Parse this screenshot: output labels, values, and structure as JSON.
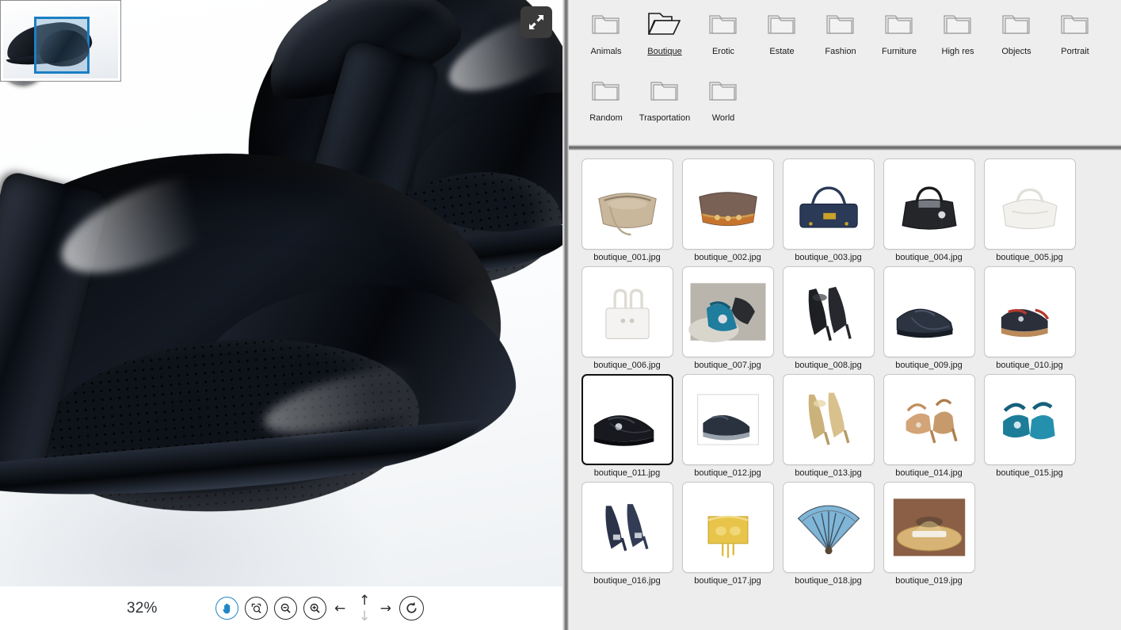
{
  "viewer": {
    "zoom_level": "32%",
    "navigator": {
      "name": "navigator-overview"
    },
    "fullscreen_icon": "expand-icon",
    "tools": [
      {
        "id": "pan",
        "icon": "hand-icon",
        "label": "Pan",
        "active": true
      },
      {
        "id": "fit",
        "icon": "fit-to-screen-icon",
        "label": "Fit to screen",
        "active": false
      },
      {
        "id": "zoom_out",
        "icon": "zoom-out-icon",
        "label": "Zoom out",
        "active": false
      },
      {
        "id": "zoom_in",
        "icon": "zoom-in-icon",
        "label": "Zoom in",
        "active": false
      }
    ],
    "arrows": {
      "left": "←",
      "up": "↑",
      "down": "↓",
      "right": "→"
    },
    "rotate_icon": "rotate-icon"
  },
  "browser": {
    "folders": [
      {
        "label": "Animals",
        "open": false
      },
      {
        "label": "Boutique",
        "open": true
      },
      {
        "label": "Erotic",
        "open": false
      },
      {
        "label": "Estate",
        "open": false
      },
      {
        "label": "Fashion",
        "open": false
      },
      {
        "label": "Furniture",
        "open": false
      },
      {
        "label": "High res",
        "open": false
      },
      {
        "label": "Objects",
        "open": false
      },
      {
        "label": "Portrait",
        "open": false
      },
      {
        "label": "Random",
        "open": false
      },
      {
        "label": "Trasportation",
        "open": false
      },
      {
        "label": "World",
        "open": false
      }
    ],
    "thumbnails": [
      {
        "name": "boutique_001.jpg",
        "kind": "handbag-tan",
        "selected": false
      },
      {
        "name": "boutique_002.jpg",
        "kind": "handbag-brown",
        "selected": false
      },
      {
        "name": "boutique_003.jpg",
        "kind": "handbag-navy",
        "selected": false
      },
      {
        "name": "boutique_004.jpg",
        "kind": "handbag-black",
        "selected": false
      },
      {
        "name": "boutique_005.jpg",
        "kind": "handbag-white",
        "selected": false
      },
      {
        "name": "boutique_006.jpg",
        "kind": "tote-white",
        "selected": false
      },
      {
        "name": "boutique_007.jpg",
        "kind": "sandals-rock",
        "selected": false
      },
      {
        "name": "boutique_008.jpg",
        "kind": "heels-black",
        "selected": false
      },
      {
        "name": "boutique_009.jpg",
        "kind": "shoes-navy",
        "selected": false
      },
      {
        "name": "boutique_010.jpg",
        "kind": "kids-shoes",
        "selected": false
      },
      {
        "name": "boutique_011.jpg",
        "kind": "loafers-black",
        "selected": true
      },
      {
        "name": "boutique_012.jpg",
        "kind": "shoes-darkblue",
        "selected": false
      },
      {
        "name": "boutique_013.jpg",
        "kind": "heels-gold",
        "selected": false
      },
      {
        "name": "boutique_014.jpg",
        "kind": "heels-tan",
        "selected": false
      },
      {
        "name": "boutique_015.jpg",
        "kind": "sandals-teal",
        "selected": false
      },
      {
        "name": "boutique_016.jpg",
        "kind": "heels-navy",
        "selected": false
      },
      {
        "name": "boutique_017.jpg",
        "kind": "gold-purse",
        "selected": false
      },
      {
        "name": "boutique_018.jpg",
        "kind": "hand-fan",
        "selected": false
      },
      {
        "name": "boutique_019.jpg",
        "kind": "straw-hat",
        "selected": false
      }
    ]
  },
  "colors": {
    "accent": "#1f86c8",
    "viewport_border": "#1b7fc4",
    "panel_bg": "#eeeeee",
    "thumb_bg": "#ededed",
    "selected_border": "#111111",
    "fullscreen_btn": "#3b3b3b"
  }
}
